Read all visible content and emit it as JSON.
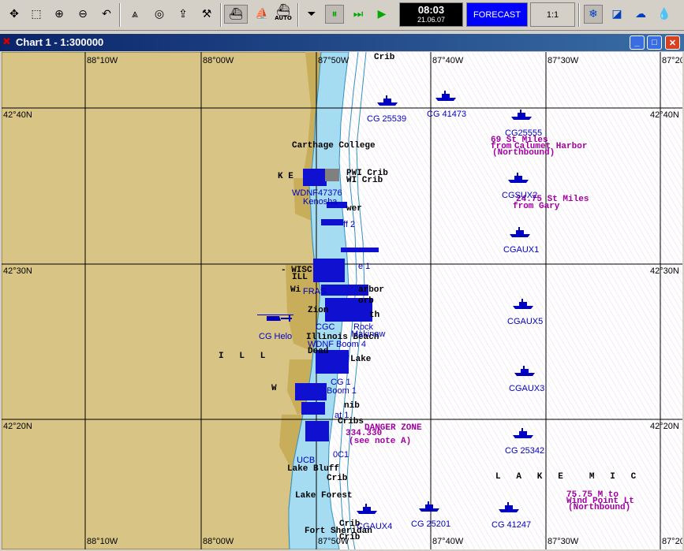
{
  "toolbar": {
    "buttons": [
      {
        "name": "move-icon",
        "glyph": "✥"
      },
      {
        "name": "select-area-icon",
        "glyph": "⬚"
      },
      {
        "name": "zoom-in-icon",
        "glyph": "⊕"
      },
      {
        "name": "zoom-out-icon",
        "glyph": "⊖"
      },
      {
        "name": "undo-icon",
        "glyph": "↶"
      },
      {
        "name": "compass-icon",
        "glyph": "⩓"
      },
      {
        "name": "target-icon",
        "glyph": "◎"
      },
      {
        "name": "export-icon",
        "glyph": "⇪"
      },
      {
        "name": "tools-icon",
        "glyph": "⚒"
      },
      {
        "name": "ship-mode-icon",
        "glyph": "⛴"
      },
      {
        "name": "ship-track-icon",
        "glyph": "⛵"
      },
      {
        "name": "auto-ship-icon",
        "glyph": "⛴",
        "caption": "AUTO"
      },
      {
        "name": "stop-icon",
        "glyph": "⏷"
      },
      {
        "name": "pause-icon",
        "glyph": "⏸"
      },
      {
        "name": "fast-forward-icon",
        "glyph": "⏭"
      },
      {
        "name": "play-icon",
        "glyph": "▶"
      },
      {
        "name": "weather-icon",
        "glyph": "❄"
      },
      {
        "name": "chart-settings-icon",
        "glyph": "◪"
      },
      {
        "name": "wind-icon",
        "glyph": "☁"
      },
      {
        "name": "current-icon",
        "glyph": "💧"
      }
    ],
    "clock_time": "08:03",
    "clock_date": "21.06.07",
    "forecast_label": "FORECAST",
    "scale_label": "1:1"
  },
  "window": {
    "title": "Chart 1 - 1:300000",
    "minimize": "_",
    "maximize": "□",
    "close": "✕"
  },
  "colors": {
    "land": "#d8c586",
    "land_dark": "#c8ad5a",
    "shallow": "#a6dcf2",
    "water": "#ffffff",
    "grid": "#000000",
    "vessel": "#0000c0",
    "magenta": "#a000a0"
  },
  "chart": {
    "lon_top": [
      "88°10W",
      "88°00W",
      "87°50W",
      "87°40W",
      "87°30W",
      "87°20"
    ],
    "lon_bottom": [
      "88°10W",
      "88°00W",
      "87°50W",
      "87°40W",
      "87°30W",
      "87°20"
    ],
    "lat_left": [
      "42°40N",
      "42°30N",
      "42°20N"
    ],
    "lat_right": [
      "42°40N",
      "42°30N",
      "42°20N"
    ],
    "places": [
      {
        "text": "Crib"
      },
      {
        "text": "Carthage College"
      },
      {
        "text": "K E"
      },
      {
        "text": "PWI Crib"
      },
      {
        "text": "WI Crib"
      },
      {
        "text": "wer"
      },
      {
        "text": "- WISC"
      },
      {
        "text": "ILL"
      },
      {
        "text": "Wi"
      },
      {
        "text": "arbor"
      },
      {
        "text": "Zion"
      },
      {
        "text": "orb"
      },
      {
        "text": "th"
      },
      {
        "text": "Illinois Beach"
      },
      {
        "text": "Dead"
      },
      {
        "text": "Lake"
      },
      {
        "text": "W"
      },
      {
        "text": "nib"
      },
      {
        "text": "Cribs"
      },
      {
        "text": "Lake Bluff"
      },
      {
        "text": "Crib"
      },
      {
        "text": "Lake Forest"
      },
      {
        "text": "Crib"
      },
      {
        "text": "Fort Sheridan"
      },
      {
        "text": "Crib"
      }
    ],
    "area_letters_ill": "I   L   L",
    "area_letters_lake": "L   A   K   E     M   I   C",
    "magenta_notes": [
      {
        "text": "69 St Miles"
      },
      {
        "text": "from"
      },
      {
        "text": "Calumet Harbor"
      },
      {
        "text": "(Northbound)"
      },
      {
        "text": "24.75 St Miles"
      },
      {
        "text": "from Gary"
      },
      {
        "text": "DANGER ZONE"
      },
      {
        "text": "334.330"
      },
      {
        "text": "(see note A)"
      },
      {
        "text": "75.75 M to"
      },
      {
        "text": "Wind Point Lt"
      },
      {
        "text": "(Northbound)"
      }
    ],
    "vessels": [
      {
        "label": "CG 25539"
      },
      {
        "label": "CG 41473"
      },
      {
        "label": "CG25555"
      },
      {
        "label": "CGSUX2"
      },
      {
        "label": "CGAUX1"
      },
      {
        "label": "CGAUX5"
      },
      {
        "label": "CGAUX3"
      },
      {
        "label": "CG 25342"
      },
      {
        "label": "CG 25201"
      },
      {
        "label": "CG 41247"
      },
      {
        "label": "CGAUX4"
      },
      {
        "label": "CG Helo"
      },
      {
        "label": "WDNF47376"
      },
      {
        "label": "Kenosha"
      },
      {
        "label": "ff 2"
      },
      {
        "label": "e 1"
      },
      {
        "label": "FRAS"
      },
      {
        "label": "CGC"
      },
      {
        "label": "Rock"
      },
      {
        "label": "Makinaw"
      },
      {
        "label": "WDNF Boom 4"
      },
      {
        "label": "CG 1"
      },
      {
        "label": "Boom 1"
      },
      {
        "label": "at 1"
      },
      {
        "label": "UCB"
      },
      {
        "label": "0C1"
      }
    ]
  }
}
